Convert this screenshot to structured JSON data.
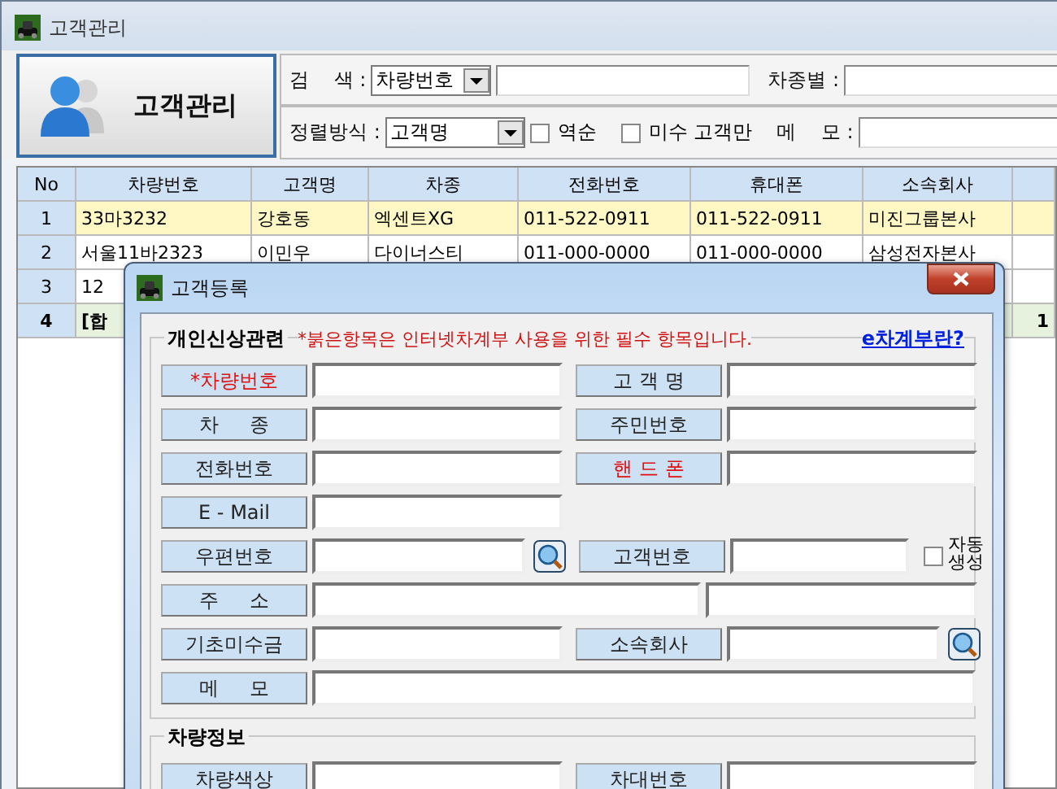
{
  "window": {
    "title": "고객관리"
  },
  "module_button": {
    "label": "고객관리"
  },
  "filters": {
    "search_label": "검    색 :",
    "search_by": "차량번호",
    "car_type_label": "차종별 :",
    "sort_label": "정렬방식 :",
    "sort_by": "고객명",
    "checkboxes": [
      {
        "label": "역순",
        "checked": false
      },
      {
        "label": "미수 고객만",
        "checked": false
      }
    ],
    "memo_label": "메    모 :"
  },
  "table": {
    "columns": [
      "No",
      "차량번호",
      "고객명",
      "차종",
      "전화번호",
      "휴대폰",
      "소속회사"
    ],
    "rows": [
      {
        "kind": "data",
        "selected": true,
        "cells": [
          "1",
          "33마3232",
          "강호동",
          "엑센트XG",
          "011-522-0911",
          "011-522-0911",
          "미진그룹본사",
          ""
        ]
      },
      {
        "kind": "data",
        "selected": false,
        "cells": [
          "2",
          "서울11바2323",
          "이민우",
          "다이너스티",
          "011-000-0000",
          "011-000-0000",
          "삼성전자본사",
          ""
        ]
      },
      {
        "kind": "data",
        "selected": false,
        "cells": [
          "3",
          "12",
          "",
          "",
          "",
          "",
          "",
          ""
        ]
      },
      {
        "kind": "total",
        "selected": false,
        "cells": [
          "4",
          "[합",
          "",
          "",
          "",
          "",
          "",
          "1"
        ]
      }
    ]
  },
  "dialog": {
    "title": "고객등록",
    "personal": {
      "title": "개인신상관련",
      "note": "*붉은항목은 인터넷차계부 사용을 위한 필수 항목입니다.",
      "link": "e차계부란?",
      "rows": [
        {
          "fields": [
            {
              "kind": "text",
              "label": "*차량번호",
              "required": true
            },
            {
              "kind": "text",
              "label": "고 객 명",
              "required": false
            }
          ]
        },
        {
          "fields": [
            {
              "kind": "text",
              "label": "차     종",
              "required": false
            },
            {
              "kind": "text",
              "label": "주민번호",
              "required": false
            }
          ]
        },
        {
          "fields": [
            {
              "kind": "text",
              "label": "전화번호",
              "required": false
            },
            {
              "kind": "text",
              "label": "핸 드 폰",
              "required": true
            }
          ]
        },
        {
          "fields": [
            {
              "kind": "text",
              "label": "E - Mail",
              "required": false
            }
          ]
        },
        {
          "fields": [
            {
              "kind": "lookup",
              "label": "우편번호",
              "required": false
            },
            {
              "kind": "auto_number",
              "label": "고객번호",
              "required": false,
              "checkbox": {
                "label": "자동 생성",
                "checked": false
              }
            }
          ]
        },
        {
          "fields": [
            {
              "kind": "address",
              "label": "주     소",
              "required": false
            }
          ]
        },
        {
          "fields": [
            {
              "kind": "text",
              "label": "기초미수금",
              "required": false
            },
            {
              "kind": "lookup",
              "label": "소속회사",
              "required": false
            }
          ]
        },
        {
          "fields": [
            {
              "kind": "memo",
              "label": "메     모",
              "required": false
            }
          ]
        }
      ]
    },
    "vehicle": {
      "title": "차량정보",
      "rows": [
        {
          "fields": [
            {
              "kind": "text",
              "label": "차량색상",
              "required": false
            },
            {
              "kind": "text",
              "label": "차대번호",
              "required": false
            }
          ]
        }
      ]
    }
  }
}
